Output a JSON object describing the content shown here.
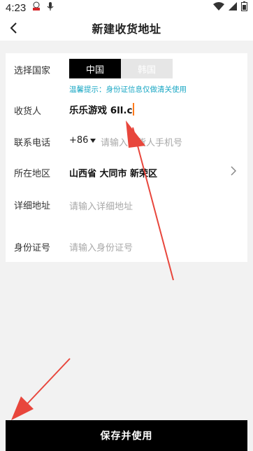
{
  "status_bar": {
    "time": "4:23"
  },
  "header": {
    "title": "新建收货地址"
  },
  "form": {
    "country": {
      "label": "选择国家",
      "options": [
        "中国",
        "韩国"
      ],
      "selected": "中国",
      "hint": "温馨提示：身份证信息仅做清关使用"
    },
    "receiver": {
      "label": "收货人",
      "value": "乐乐游戏 6ll.c"
    },
    "phone": {
      "label": "联系电话",
      "code": "+86",
      "placeholder": "请输入收货人手机号"
    },
    "region": {
      "label": "所在地区",
      "value": "山西省 大同市 新荣区"
    },
    "detail": {
      "label": "详细地址",
      "placeholder": "请输入详细地址"
    },
    "id_number": {
      "label": "身份证号",
      "placeholder": "请输入身份证号"
    }
  },
  "footer": {
    "submit_label": "保存并使用"
  },
  "colors": {
    "accent": "#1aa7c4",
    "annotation": "#e8463c",
    "caret": "#ff7a1a"
  }
}
